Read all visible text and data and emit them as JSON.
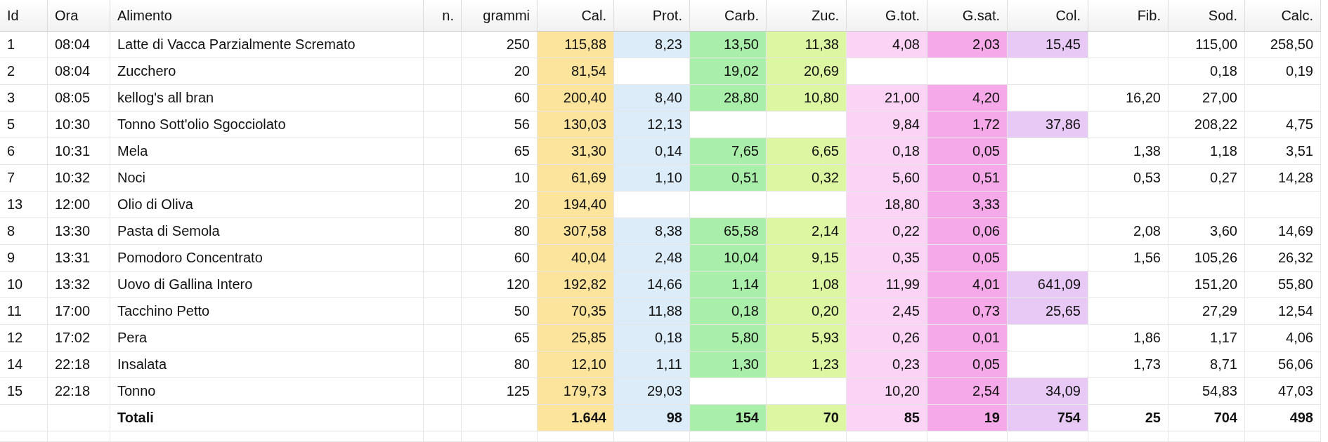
{
  "table": {
    "columns": [
      {
        "label": "Id",
        "kind": "text"
      },
      {
        "label": "Ora",
        "kind": "text"
      },
      {
        "label": "Alimento",
        "kind": "text"
      },
      {
        "label": "n.",
        "kind": "number"
      },
      {
        "label": "grammi",
        "kind": "number"
      },
      {
        "label": "Cal.",
        "kind": "number",
        "color": "#fce49c"
      },
      {
        "label": "Prot.",
        "kind": "number",
        "color": "#dcedf9"
      },
      {
        "label": "Carb.",
        "kind": "number",
        "color": "#a9efa9"
      },
      {
        "label": "Zuc.",
        "kind": "number",
        "color": "#ddf6a2"
      },
      {
        "label": "G.tot.",
        "kind": "number",
        "color": "#fad3f5"
      },
      {
        "label": "G.sat.",
        "kind": "number",
        "color": "#f6a9e8"
      },
      {
        "label": "Col.",
        "kind": "number",
        "color": "#e8c9f6"
      },
      {
        "label": "Fib.",
        "kind": "number"
      },
      {
        "label": "Sod.",
        "kind": "number"
      },
      {
        "label": "Calc.",
        "kind": "number"
      }
    ],
    "rows": [
      {
        "kind": "item",
        "cells": [
          "1",
          "08:04",
          "Latte di Vacca Parzialmente Scremato",
          null,
          "250",
          "115,88",
          "8,23",
          "13,50",
          "11,38",
          "4,08",
          "2,03",
          "15,45",
          null,
          "115,00",
          "258,50"
        ]
      },
      {
        "kind": "item",
        "cells": [
          "2",
          "08:04",
          "Zucchero",
          null,
          "20",
          "81,54",
          null,
          "19,02",
          "20,69",
          null,
          null,
          null,
          null,
          "0,18",
          "0,19"
        ]
      },
      {
        "kind": "item",
        "cells": [
          "3",
          "08:05",
          "kellog's all bran",
          null,
          "60",
          "200,40",
          "8,40",
          "28,80",
          "10,80",
          "21,00",
          "4,20",
          null,
          "16,20",
          "27,00",
          null
        ]
      },
      {
        "kind": "item",
        "cells": [
          "5",
          "10:30",
          "Tonno Sott'olio Sgocciolato",
          null,
          "56",
          "130,03",
          "12,13",
          null,
          null,
          "9,84",
          "1,72",
          "37,86",
          null,
          "208,22",
          "4,75"
        ]
      },
      {
        "kind": "item",
        "cells": [
          "6",
          "10:31",
          "Mela",
          null,
          "65",
          "31,30",
          "0,14",
          "7,65",
          "6,65",
          "0,18",
          "0,05",
          null,
          "1,38",
          "1,18",
          "3,51"
        ]
      },
      {
        "kind": "item",
        "cells": [
          "7",
          "10:32",
          "Noci",
          null,
          "10",
          "61,69",
          "1,10",
          "0,51",
          "0,32",
          "5,60",
          "0,51",
          null,
          "0,53",
          "0,27",
          "14,28"
        ]
      },
      {
        "kind": "item",
        "cells": [
          "13",
          "12:00",
          "Olio di Oliva",
          null,
          "20",
          "194,40",
          null,
          null,
          null,
          "18,80",
          "3,33",
          null,
          null,
          null,
          null
        ]
      },
      {
        "kind": "item",
        "cells": [
          "8",
          "13:30",
          "Pasta di Semola",
          null,
          "80",
          "307,58",
          "8,38",
          "65,58",
          "2,14",
          "0,22",
          "0,06",
          null,
          "2,08",
          "3,60",
          "14,69"
        ]
      },
      {
        "kind": "item",
        "cells": [
          "9",
          "13:31",
          "Pomodoro Concentrato",
          null,
          "60",
          "40,04",
          "2,48",
          "10,04",
          "9,15",
          "0,35",
          "0,05",
          null,
          "1,56",
          "105,26",
          "26,32"
        ]
      },
      {
        "kind": "item",
        "cells": [
          "10",
          "13:32",
          "Uovo di Gallina Intero",
          null,
          "120",
          "192,82",
          "14,66",
          "1,14",
          "1,08",
          "11,99",
          "4,01",
          "641,09",
          null,
          "151,20",
          "55,80"
        ]
      },
      {
        "kind": "item",
        "cells": [
          "11",
          "17:00",
          "Tacchino Petto",
          null,
          "50",
          "70,35",
          "11,88",
          "0,18",
          "0,20",
          "2,45",
          "0,73",
          "25,65",
          null,
          "27,29",
          "12,54"
        ]
      },
      {
        "kind": "item",
        "cells": [
          "12",
          "17:02",
          "Pera",
          null,
          "65",
          "25,85",
          "0,18",
          "5,80",
          "5,93",
          "0,26",
          "0,01",
          null,
          "1,86",
          "1,17",
          "4,06"
        ]
      },
      {
        "kind": "item",
        "cells": [
          "14",
          "22:18",
          "Insalata",
          null,
          "80",
          "12,10",
          "1,11",
          "1,30",
          "1,23",
          "0,23",
          "0,05",
          null,
          "1,73",
          "8,71",
          "56,06"
        ]
      },
      {
        "kind": "item",
        "cells": [
          "15",
          "22:18",
          "Tonno",
          null,
          "125",
          "179,73",
          "29,03",
          null,
          null,
          "10,20",
          "2,54",
          "34,09",
          null,
          "54,83",
          "47,03"
        ]
      },
      {
        "kind": "total",
        "cells": [
          null,
          null,
          "Totali",
          null,
          null,
          "1.644",
          "98",
          "154",
          "70",
          "85",
          "19",
          "754",
          "25",
          "704",
          "498"
        ]
      }
    ]
  }
}
